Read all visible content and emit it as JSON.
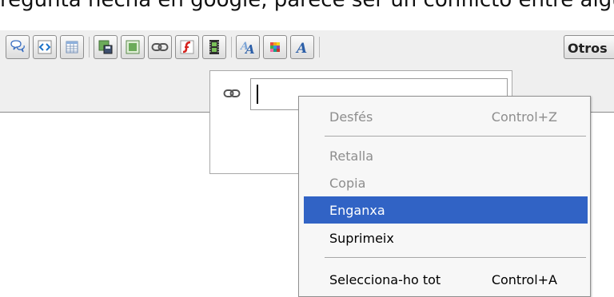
{
  "top_text": "regunta hecha en google, parece ser un conflicto entre algu",
  "toolbar": {
    "buttons": [
      {
        "icon": "comment-icon"
      },
      {
        "icon": "code-icon"
      },
      {
        "icon": "table-icon"
      },
      {
        "icon": "save-image-icon"
      },
      {
        "icon": "image-icon"
      },
      {
        "icon": "link-icon"
      },
      {
        "icon": "flash-icon"
      },
      {
        "icon": "film-icon"
      },
      {
        "icon": "font-size-icon"
      },
      {
        "icon": "color-palette-icon"
      },
      {
        "icon": "font-style-icon"
      }
    ],
    "otros_label": "Otros"
  },
  "link_popup": {
    "icon": "link-icon",
    "url_value": ""
  },
  "context_menu": {
    "items": [
      {
        "label": "Desfés",
        "shortcut": "Control+Z",
        "state": "disabled"
      },
      {
        "label": "Retalla",
        "shortcut": "",
        "state": "disabled"
      },
      {
        "label": "Copia",
        "shortcut": "",
        "state": "disabled"
      },
      {
        "label": "Enganxa",
        "shortcut": "",
        "state": "highlighted"
      },
      {
        "label": "Suprimeix",
        "shortcut": "",
        "state": "enabled"
      },
      {
        "label": "Selecciona-ho tot",
        "shortcut": "Control+A",
        "state": "enabled"
      }
    ]
  },
  "colors": {
    "highlight": "#3163c5",
    "disabled_text": "#8d8d8d",
    "toolbar_bg": "#efefef"
  }
}
